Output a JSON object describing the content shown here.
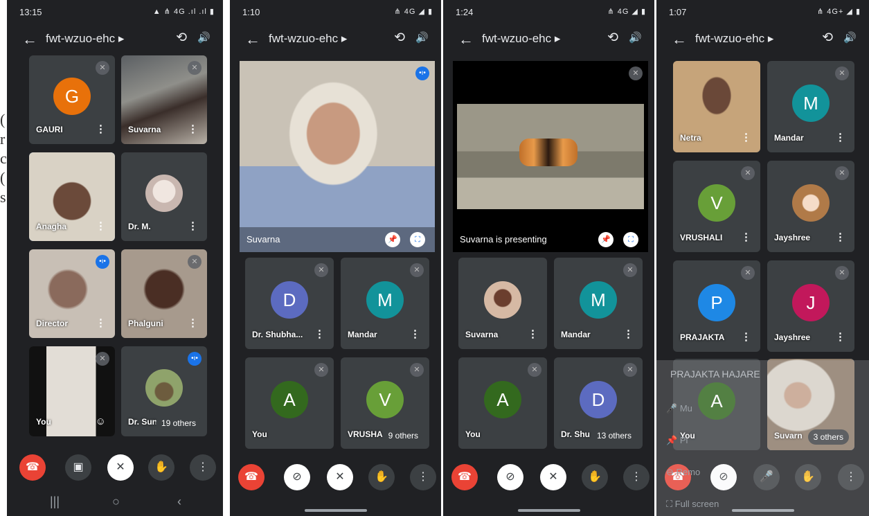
{
  "left_fragment": [
    "(",
    "r",
    "c",
    "(",
    "s"
  ],
  "phones": [
    {
      "status_time": "13:15",
      "status_right": "▲ ⋔ 4G .ıl .ıl ▮",
      "meeting_title": "fwt-wzuo-ehc",
      "tiles": [
        {
          "name": "GAURI",
          "initial": "G",
          "color": "#e8710a"
        },
        {
          "name": "Suvarna"
        },
        {
          "name": "Anagha"
        },
        {
          "name": "Dr. M."
        },
        {
          "name": "Director"
        },
        {
          "name": "Phalguni"
        },
        {
          "name": "You"
        },
        {
          "name": "Dr. Sun"
        }
      ],
      "others": "19 others"
    },
    {
      "status_time": "1:10",
      "status_right": "⋔ 4G ◢ ▮",
      "meeting_title": "fwt-wzuo-ehc",
      "main_name": "Suvarna",
      "tiles": [
        {
          "name": "Dr. Shubha...",
          "initial": "D",
          "color": "#5c6bc0"
        },
        {
          "name": "Mandar",
          "initial": "M",
          "color": "#12939a"
        },
        {
          "name": "You",
          "initial": "A",
          "color": "#33691e"
        },
        {
          "name": "VRUSHA",
          "initial": "V",
          "color": "#689f38"
        }
      ],
      "others": "9 others"
    },
    {
      "status_time": "1:24",
      "status_right": "⋔ 4G ◢ ▮",
      "meeting_title": "fwt-wzuo-ehc",
      "presenting": "Suvarna is presenting",
      "tiles": [
        {
          "name": "Suvarna"
        },
        {
          "name": "Mandar",
          "initial": "M",
          "color": "#12939a"
        },
        {
          "name": "You",
          "initial": "A",
          "color": "#33691e"
        },
        {
          "name": "Dr. Shu",
          "initial": "D",
          "color": "#5c6bc0"
        }
      ],
      "others": "13 others"
    },
    {
      "status_time": "1:07",
      "status_right": "⋔ 4G+ ◢ ▮",
      "meeting_title": "fwt-wzuo-ehc",
      "tiles": [
        {
          "name": "Netra"
        },
        {
          "name": "Mandar",
          "initial": "M",
          "color": "#12939a"
        },
        {
          "name": "VRUSHALI",
          "initial": "V",
          "color": "#689f38"
        },
        {
          "name": "Jayshree"
        },
        {
          "name": "PRAJAKTA",
          "initial": "P",
          "color": "#1e88e5"
        },
        {
          "name": "Jayshree",
          "initial": "J",
          "color": "#c2185b"
        },
        {
          "name": "You",
          "initial": "A",
          "color": "#33691e"
        },
        {
          "name": "Suvarn"
        }
      ],
      "others": "3 others",
      "overlay": {
        "header": "PRAJAKTA HAJARE",
        "items": [
          "Mu",
          "Pi",
          "Remo",
          "Full screen"
        ]
      }
    }
  ]
}
